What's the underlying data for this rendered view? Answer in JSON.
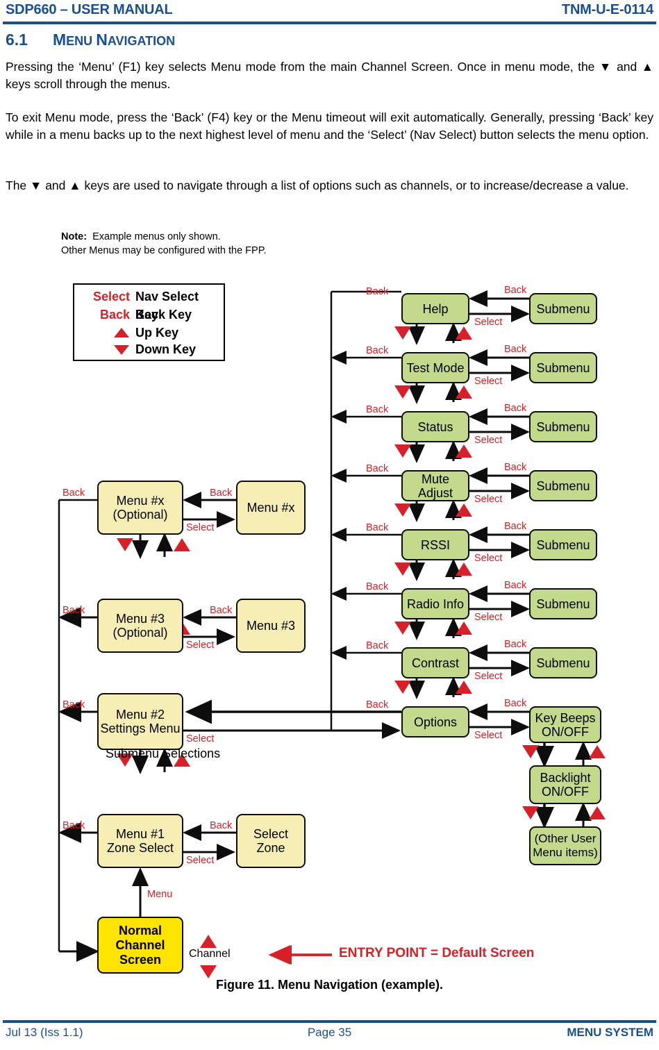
{
  "header": {
    "left": "SDP660 – USER MANUAL",
    "right": "TNM-U-E-0114"
  },
  "heading": {
    "number": "6.1",
    "title_first": "M",
    "title_rest": "ENU ",
    "title_first2": "N",
    "title_rest2": "AVIGATION"
  },
  "paragraphs": [
    "Pressing the ‘Menu’ (F1) key selects Menu mode from the main Channel Screen.  Once in menu mode, the ▼ and ▲ keys scroll through the menus.",
    "To exit Menu mode, press the ‘Back’ (F4) key or the Menu timeout will exit automatically. Generally, pressing ‘Back’ key while in a menu backs up to the next highest level of menu and the ‘Select’ (Nav Select) button selects the menu option.",
    "The ▼ and ▲ keys are used to navigate through a list of options such as channels, or to increase/decrease a value."
  ],
  "note": {
    "label": "Note:",
    "line1": "Example menus only shown.",
    "line2": "Other Menus may be configured with the FPP."
  },
  "legend": {
    "rows": [
      {
        "key": "Select",
        "desc": "Nav Select Key",
        "icon": "text"
      },
      {
        "key": "Back",
        "desc": "Back Key",
        "icon": "text"
      },
      {
        "key": "",
        "desc": "Up Key",
        "icon": "triangle-up-icon"
      },
      {
        "key": "",
        "desc": "Down Key",
        "icon": "triangle-down-icon"
      }
    ]
  },
  "diagram": {
    "labels": {
      "back": "Back",
      "select": "Select",
      "menu": "Menu",
      "channel": "Channel"
    },
    "submenu_selections": "Submenu Selections",
    "entry_point": "ENTRY POINT = Default Screen",
    "left_column": [
      {
        "line1": "Menu #x",
        "line2": "(Optional)",
        "target": "Menu #x"
      },
      {
        "line1": "Menu #3",
        "line2": "(Optional)",
        "target": "Menu #3"
      },
      {
        "line1": "Menu #2",
        "line2": "Settings Menu",
        "target": ""
      },
      {
        "line1": "Menu #1",
        "line2": "Zone Select",
        "target_line1": "Select",
        "target_line2": "Zone"
      }
    ],
    "normal_screen": {
      "line1": "Normal",
      "line2": "Channel",
      "line3": "Screen"
    },
    "right_column": [
      {
        "line1": "Help",
        "line2": "",
        "target": "Submenu"
      },
      {
        "line1": "Test Mode",
        "line2": "",
        "target": "Submenu"
      },
      {
        "line1": "Status",
        "line2": "",
        "target": "Submenu"
      },
      {
        "line1": "Mute",
        "line2": "Adjust",
        "target": "Submenu"
      },
      {
        "line1": "RSSI",
        "line2": "",
        "target": "Submenu"
      },
      {
        "line1": "Radio Info",
        "line2": "",
        "target": "Submenu"
      },
      {
        "line1": "Contrast",
        "line2": "",
        "target": "Submenu"
      },
      {
        "line1": "Options",
        "line2": "",
        "target": ""
      }
    ],
    "user_menu": [
      {
        "line1": "Key Beeps",
        "line2": "ON/OFF"
      },
      {
        "line1": "Backlight",
        "line2": "ON/OFF"
      },
      {
        "line1": "(Other User",
        "line2": "Menu items)"
      }
    ]
  },
  "figure_caption": "Figure 11.  Menu Navigation (example).",
  "footer": {
    "left": "Jul 13 (Iss 1.1)",
    "center": "Page 35",
    "right": "MENU SYSTEM"
  },
  "colors": {
    "brand_blue": "#1a4f8f",
    "red": "#d81f26",
    "green_node": "#c3d98b",
    "cream_node": "#f7eeb5",
    "yellow_node": "#ffe400"
  }
}
